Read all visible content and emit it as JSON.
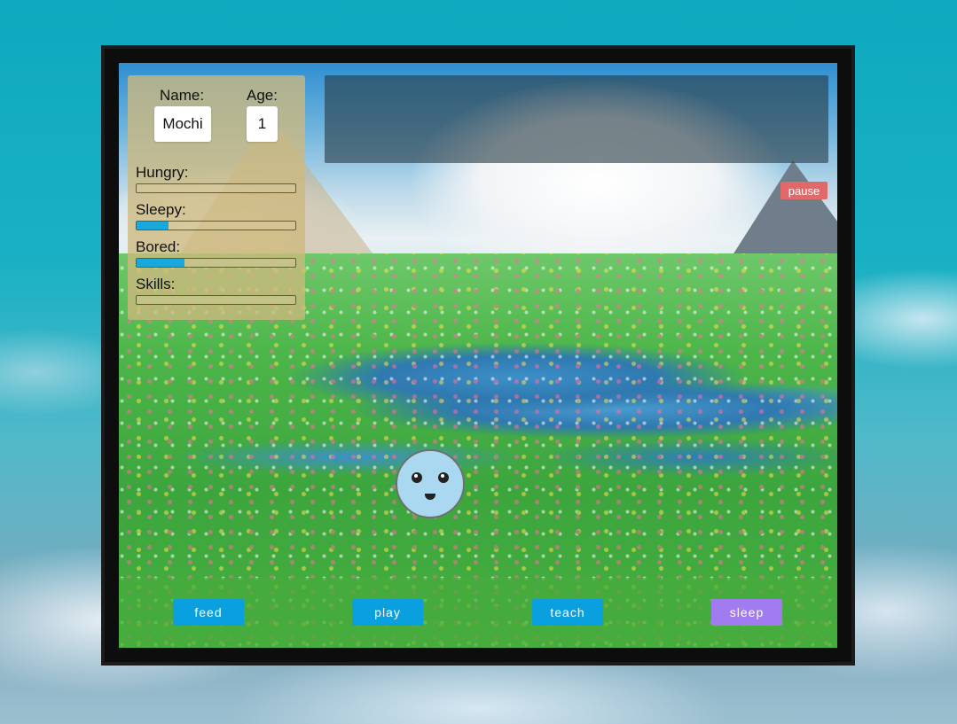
{
  "pet": {
    "name_label": "Name:",
    "name": "Mochi",
    "age_label": "Age:",
    "age": "1"
  },
  "stats": [
    {
      "label": "Hungry:",
      "level": 0.0
    },
    {
      "label": "Sleepy:",
      "level": 0.2
    },
    {
      "label": "Bored:",
      "level": 0.3
    },
    {
      "label": "Skills:",
      "level": 0.0
    }
  ],
  "controls": {
    "pause_label": "pause",
    "feed_label": "feed",
    "play_label": "play",
    "teach_label": "teach",
    "sleep_label": "sleep"
  },
  "colors": {
    "stat_fill": "#1aa7dc",
    "action_button": "#0aa0e0",
    "sleep_button": "#a17cf0",
    "pause_button": "#e06a6a",
    "pet_body": "#a9d8f0"
  }
}
